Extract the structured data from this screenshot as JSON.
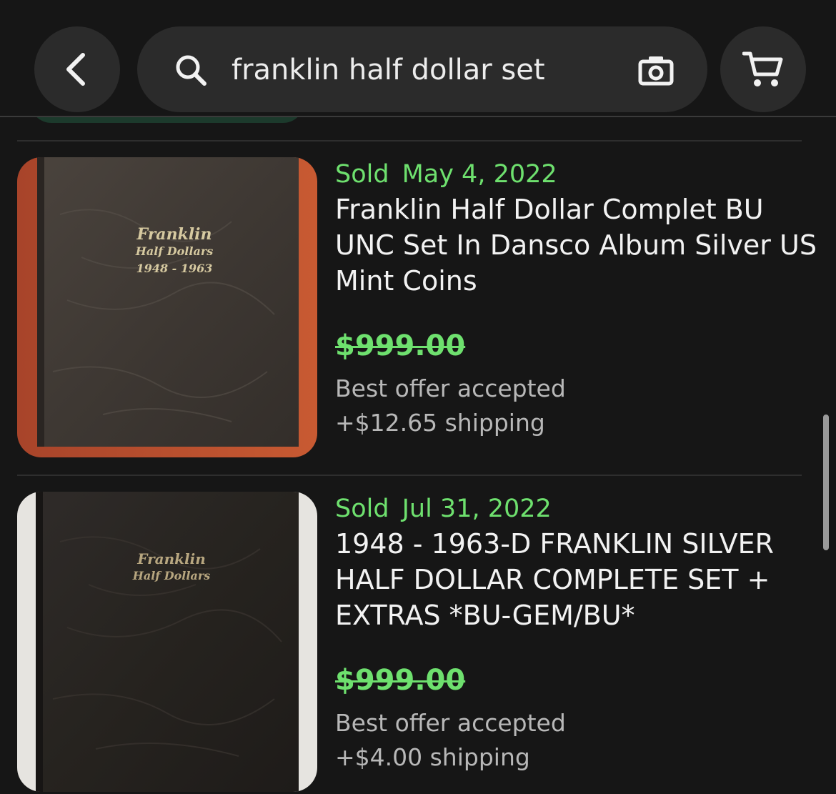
{
  "search": {
    "query": "franklin half dollar set"
  },
  "icons": {
    "back": "chevron-left-icon",
    "search": "search-icon",
    "camera": "camera-icon",
    "cart": "cart-icon"
  },
  "colors": {
    "background": "#161616",
    "surface": "#2b2b2b",
    "sold_green": "#6ee06e",
    "secondary_text": "#b8b8b8"
  },
  "listings": [
    {
      "sold_label": "Sold",
      "sold_date": "May 4, 2022",
      "title": "Franklin Half Dollar Complet BU UNC Set In Dansco Album Silver US Mint Coins",
      "price": "$999.00",
      "offer": "Best offer accepted",
      "shipping": "+$12.65 shipping",
      "image_text_1": "Franklin",
      "image_text_2": "Half Dollars",
      "image_text_3": "1948 - 1963"
    },
    {
      "sold_label": "Sold",
      "sold_date": "Jul 31, 2022",
      "title": "1948 - 1963-D FRANKLIN SILVER HALF DOLLAR COMPLETE SET + EXTRAS *BU-GEM/BU*",
      "price": "$999.00",
      "offer": "Best offer accepted",
      "shipping": "+$4.00 shipping",
      "image_text_1": "Franklin",
      "image_text_2": "Half Dollars"
    }
  ]
}
